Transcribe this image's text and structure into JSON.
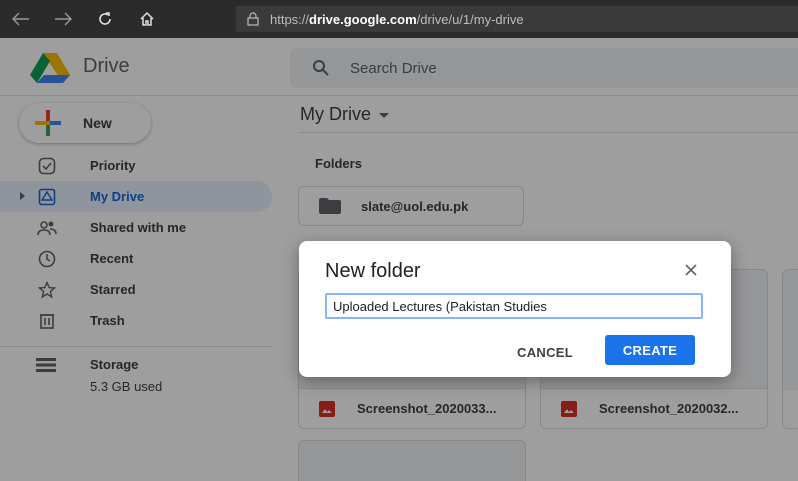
{
  "browser": {
    "url_prefix": "https://",
    "url_host": "drive.google.com",
    "url_path": "/drive/u/1/my-drive"
  },
  "header": {
    "brand": "Drive",
    "search_placeholder": "Search Drive"
  },
  "new_button_label": "New",
  "sidebar": {
    "items": [
      {
        "label": "Priority",
        "icon": "priority-icon"
      },
      {
        "label": "My Drive",
        "icon": "my-drive-icon",
        "active": true
      },
      {
        "label": "Shared with me",
        "icon": "shared-icon"
      },
      {
        "label": "Recent",
        "icon": "clock-icon"
      },
      {
        "label": "Starred",
        "icon": "star-icon"
      },
      {
        "label": "Trash",
        "icon": "trash-icon"
      }
    ],
    "storage": {
      "label": "Storage",
      "used": "5.3 GB used"
    }
  },
  "main": {
    "title": "My Drive",
    "section_folders": "Folders",
    "folders": [
      {
        "name": "slate@uol.edu.pk"
      }
    ],
    "files": [
      {
        "name": "Screenshot_2020033..."
      },
      {
        "name": "Screenshot_2020032..."
      }
    ]
  },
  "dialog": {
    "title": "New folder",
    "input_value": "Uploaded Lectures (Pakistan Studies",
    "cancel_label": "CANCEL",
    "create_label": "CREATE"
  },
  "colors": {
    "accent": "#1a73e8",
    "active_bg": "#e8f0fe",
    "chrome_bg": "#2b2b2b"
  }
}
